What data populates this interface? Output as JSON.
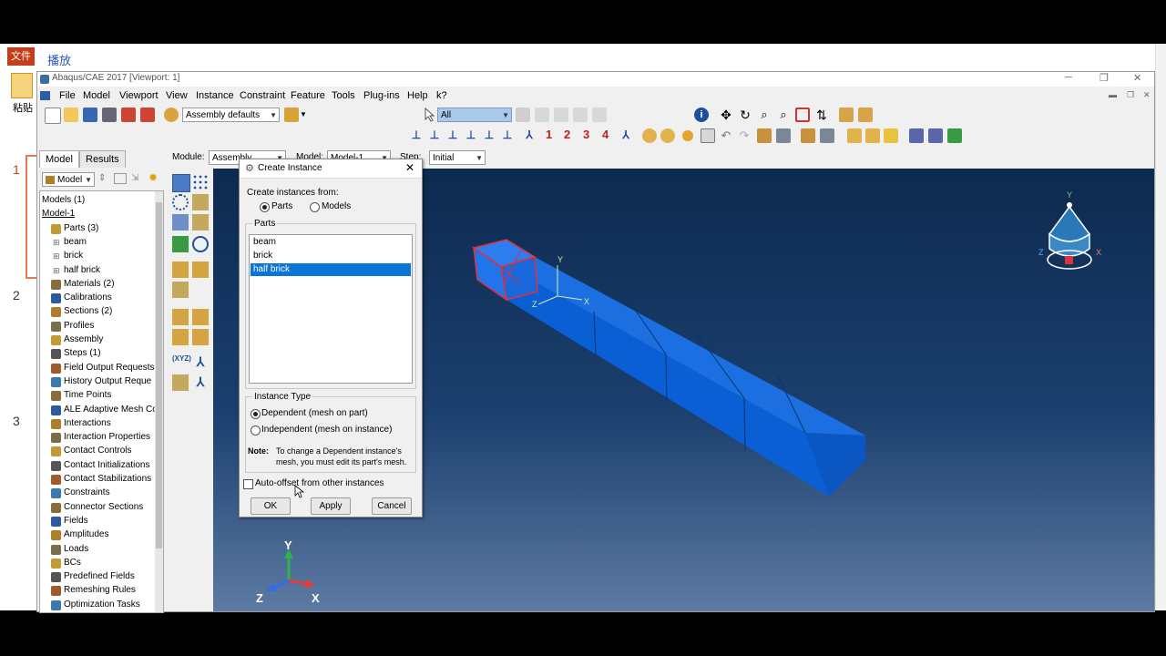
{
  "background": {
    "tab_label": "文件",
    "title": "播放",
    "paste_label": "粘贴",
    "slide_numbers": [
      "1",
      "2",
      "3"
    ]
  },
  "window": {
    "title": "Abaqus/CAE 2017 [Viewport: 1]"
  },
  "menu": [
    "File",
    "Model",
    "Viewport",
    "View",
    "Instance",
    "Constraint",
    "Feature",
    "Tools",
    "Plug-ins",
    "Help",
    "k?"
  ],
  "toolbar": {
    "assembly_select": "Assembly defaults",
    "selection_filter": "All",
    "numbers": [
      "1",
      "2",
      "3",
      "4"
    ]
  },
  "module_bar": {
    "module_label": "Module:",
    "module_value": "Assembly",
    "model_label": "Model:",
    "model_value": "Model-1",
    "step_label": "Step:",
    "step_value": "Initial"
  },
  "tabs": [
    "Model",
    "Results"
  ],
  "tree": {
    "model_select": "Model",
    "items": [
      {
        "label": "Models (1)",
        "level": 0
      },
      {
        "label": "Model-1",
        "level": 0
      },
      {
        "label": "Parts (3)",
        "level": 1
      },
      {
        "label": "beam",
        "level": 2
      },
      {
        "label": "brick",
        "level": 2
      },
      {
        "label": "half brick",
        "level": 2
      },
      {
        "label": "Materials (2)",
        "level": 1
      },
      {
        "label": "Calibrations",
        "level": 1
      },
      {
        "label": "Sections (2)",
        "level": 1
      },
      {
        "label": "Profiles",
        "level": 1
      },
      {
        "label": "Assembly",
        "level": 1
      },
      {
        "label": "Steps (1)",
        "level": 1
      },
      {
        "label": "Field Output Requests",
        "level": 1
      },
      {
        "label": "History Output Reque",
        "level": 1
      },
      {
        "label": "Time Points",
        "level": 1
      },
      {
        "label": "ALE Adaptive Mesh Co",
        "level": 1
      },
      {
        "label": "Interactions",
        "level": 1
      },
      {
        "label": "Interaction Properties",
        "level": 1
      },
      {
        "label": "Contact Controls",
        "level": 1
      },
      {
        "label": "Contact Initializations",
        "level": 1
      },
      {
        "label": "Contact Stabilizations",
        "level": 1
      },
      {
        "label": "Constraints",
        "level": 1
      },
      {
        "label": "Connector Sections",
        "level": 1
      },
      {
        "label": "Fields",
        "level": 1
      },
      {
        "label": "Amplitudes",
        "level": 1
      },
      {
        "label": "Loads",
        "level": 1
      },
      {
        "label": "BCs",
        "level": 1
      },
      {
        "label": "Predefined Fields",
        "level": 1
      },
      {
        "label": "Remeshing Rules",
        "level": 1
      },
      {
        "label": "Optimization Tasks",
        "level": 1
      }
    ]
  },
  "dialog": {
    "title": "Create Instance",
    "create_from_label": "Create instances from:",
    "opt_parts": "Parts",
    "opt_models": "Models",
    "parts_group": "Parts",
    "parts": [
      "beam",
      "brick",
      "half brick"
    ],
    "selected_part": "half brick",
    "instance_type_label": "Instance Type",
    "dependent_label": "Dependent (mesh on part)",
    "independent_label": "Independent (mesh on instance)",
    "note_label": "Note:",
    "note_text_1": "To change a Dependent instance's",
    "note_text_2": "mesh, you must edit its part's mesh.",
    "auto_offset_label": "Auto-offset from other instances",
    "ok": "OK",
    "apply": "Apply",
    "cancel": "Cancel"
  },
  "viewport": {
    "triad": {
      "x": "X",
      "y": "Y",
      "z": "Z"
    },
    "view_cube": {
      "x": "X",
      "y": "Y",
      "z": "Z"
    },
    "local_axes": {
      "x": "X",
      "y": "Y",
      "z": "Z"
    }
  },
  "colors": {
    "part_blue": "#0a6ae0",
    "selected_red": "#e0303a",
    "selection_blue": "#0b74d7",
    "number_red": "#c0201a"
  }
}
